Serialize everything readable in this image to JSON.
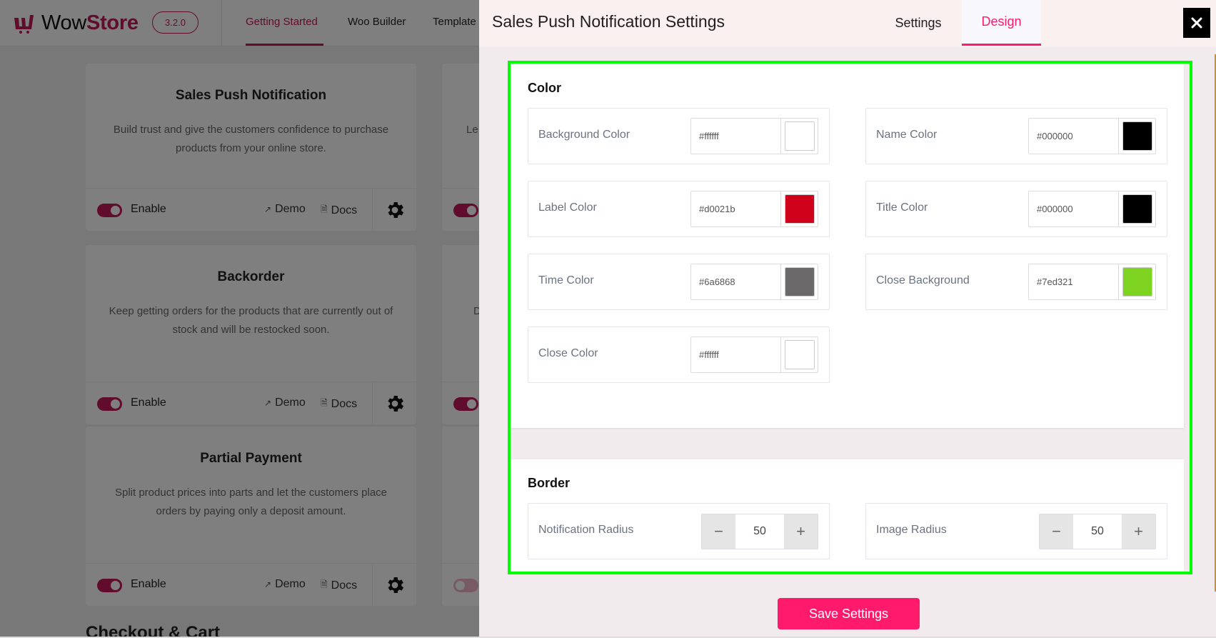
{
  "app": {
    "logo_prefix": "Wow",
    "logo_suffix": "Store",
    "version": "3.2.0",
    "brand_color": "#c2185b",
    "nav": [
      {
        "label": "Getting Started",
        "active": true
      },
      {
        "label": "Woo Builder",
        "active": false
      },
      {
        "label": "Template",
        "active": false
      }
    ],
    "cards": [
      {
        "title": "Sales Push Notification",
        "description": "Build trust and give the customers confidence to purchase products from your online store.",
        "toggle_label": "Enable",
        "enabled": true,
        "demo_label": "Demo",
        "docs_label": "Docs"
      },
      {
        "title": "Backorder",
        "description": "Keep getting orders for the products that are currently out of stock and will be restocked soon.",
        "toggle_label": "Enable",
        "enabled": true,
        "demo_label": "Demo",
        "docs_label": "Docs"
      },
      {
        "title": "Partial Payment",
        "description": "Split product prices into parts and let the customers place orders by paying only a deposit amount.",
        "toggle_label": "Enable",
        "enabled": true,
        "demo_label": "Demo",
        "docs_label": "Docs"
      }
    ],
    "right_cards_partial": [
      {
        "desc_fragment": "Le",
        "enabled": true
      },
      {
        "desc_fragment": "D",
        "enabled": true
      },
      {
        "desc_fragment": "",
        "enabled": false
      }
    ],
    "next_section_heading": "Checkout & Cart"
  },
  "panel": {
    "title": "Sales Push Notification Settings",
    "tabs": [
      {
        "label": "Settings",
        "active": false
      },
      {
        "label": "Design",
        "active": true
      }
    ],
    "accent_color": "#ff1a6c",
    "color_section": {
      "title": "Color",
      "fields": [
        {
          "label": "Background Color",
          "value": "#ffffff"
        },
        {
          "label": "Name Color",
          "value": "#000000"
        },
        {
          "label": "Label Color",
          "value": "#d0021b"
        },
        {
          "label": "Title Color",
          "value": "#000000"
        },
        {
          "label": "Time Color",
          "value": "#6a6868"
        },
        {
          "label": "Close Background",
          "value": "#7ed321"
        },
        {
          "label": "Close Color",
          "value": "#ffffff"
        }
      ]
    },
    "border_section": {
      "title": "Border",
      "fields": [
        {
          "label": "Notification Radius",
          "value": "50"
        },
        {
          "label": "Image Radius",
          "value": "50"
        }
      ]
    },
    "save_label": "Save Settings"
  }
}
